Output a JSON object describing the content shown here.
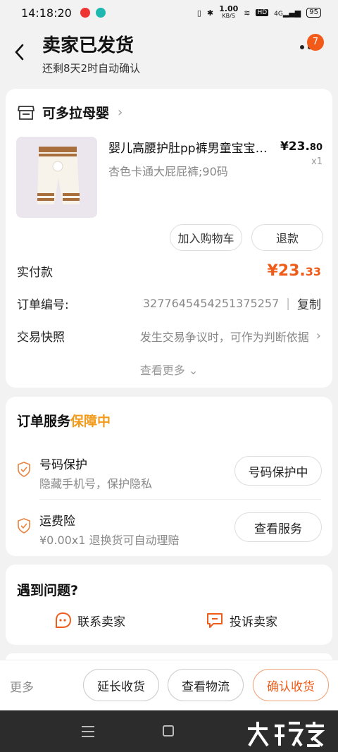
{
  "status_bar": {
    "time": "14:18:20",
    "net_speed": "1.00",
    "net_unit": "KB/S",
    "hd": "HD",
    "signal": "4G",
    "battery": "95"
  },
  "header": {
    "title": "卖家已发货",
    "subtitle": "还剩8天2时自动确认",
    "badge": "7"
  },
  "order": {
    "store_name": "可多拉母婴",
    "product_title": "婴儿高腰护肚pp裤男童宝宝…",
    "product_spec": "杏色卡通大屁屁裤;90码",
    "price_main": "¥23.",
    "price_cents": "80",
    "quantity": "x1",
    "btn_cart": "加入购物车",
    "btn_refund": "退款",
    "paid_label": "实付款",
    "paid_main": "¥23.",
    "paid_cents": "33",
    "order_no_label": "订单编号:",
    "order_no": "3277645454251375257",
    "copy_label": "复制",
    "snapshot_label": "交易快照",
    "snapshot_desc": "发生交易争议时，可作为判断依据",
    "see_more": "查看更多"
  },
  "services": {
    "title": "订单服务",
    "title_highlight": "保障中",
    "items": [
      {
        "name": "号码保护",
        "desc": "隐藏手机号，保护隐私",
        "button": "号码保护中"
      },
      {
        "name": "运费险",
        "desc": "¥0.00x1  退换货可自动理赔",
        "button": "查看服务"
      }
    ]
  },
  "problems": {
    "title": "遇到问题?",
    "contact": "联系卖家",
    "complain": "投诉卖家"
  },
  "bottom_bar": {
    "more": "更多",
    "extend": "延长收货",
    "logistics": "查看物流",
    "confirm": "确认收货"
  },
  "colors": {
    "accent": "#ef5b19",
    "highlight": "#f39a1b"
  }
}
